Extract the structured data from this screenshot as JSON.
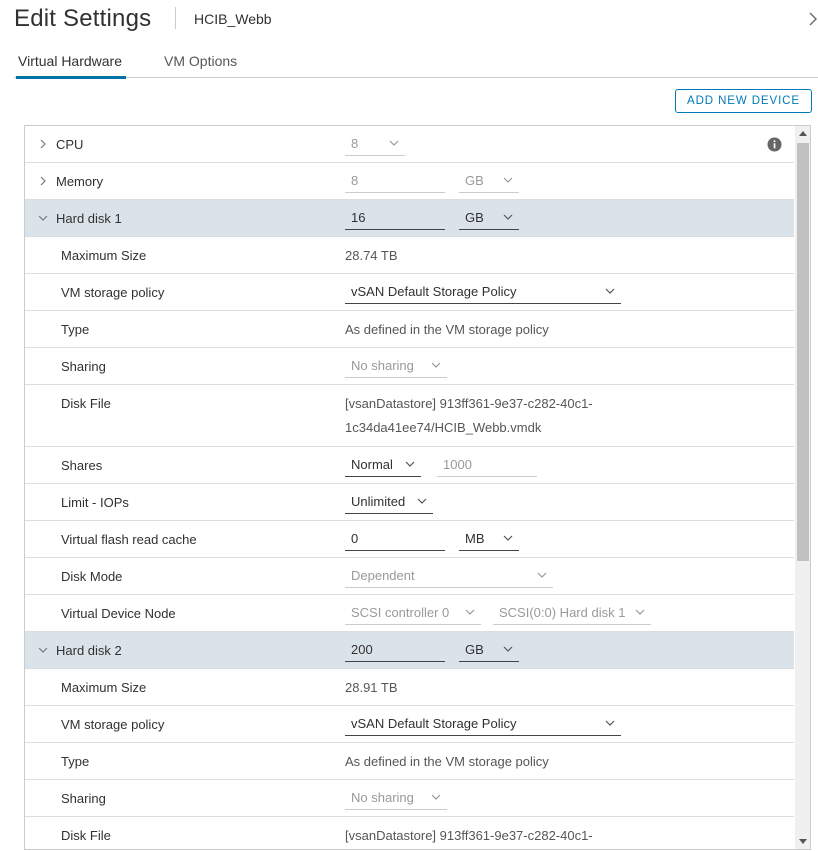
{
  "header": {
    "title": "Edit Settings",
    "vm_name": "HCIB_Webb"
  },
  "tabs": [
    {
      "label": "Virtual Hardware"
    },
    {
      "label": "VM Options"
    }
  ],
  "toolbar": {
    "add_device_label": "ADD NEW DEVICE"
  },
  "cpu": {
    "label": "CPU",
    "value": "8"
  },
  "memory": {
    "label": "Memory",
    "value": "8",
    "unit": "GB"
  },
  "disk1": {
    "label": "Hard disk 1",
    "size": "16",
    "unit": "GB",
    "max_size_label": "Maximum Size",
    "max_size": "28.74 TB",
    "policy_label": "VM storage policy",
    "policy": "vSAN Default Storage Policy",
    "type_label": "Type",
    "type": "As defined in the VM storage policy",
    "sharing_label": "Sharing",
    "sharing": "No sharing",
    "file_label": "Disk File",
    "file_line1": "[vsanDatastore] 913ff361-9e37-c282-40c1-",
    "file_line2": "1c34da41ee74/HCIB_Webb.vmdk",
    "shares_label": "Shares",
    "shares": "Normal",
    "shares_value": "1000",
    "limit_label": "Limit - IOPs",
    "limit": "Unlimited",
    "cache_label": "Virtual flash read cache",
    "cache": "0",
    "cache_unit": "MB",
    "mode_label": "Disk Mode",
    "mode": "Dependent",
    "node_label": "Virtual Device Node",
    "controller": "SCSI controller 0",
    "node": "SCSI(0:0) Hard disk 1"
  },
  "disk2": {
    "label": "Hard disk 2",
    "size": "200",
    "unit": "GB",
    "max_size_label": "Maximum Size",
    "max_size": "28.91 TB",
    "policy_label": "VM storage policy",
    "policy": "vSAN Default Storage Policy",
    "type_label": "Type",
    "type": "As defined in the VM storage policy",
    "sharing_label": "Sharing",
    "sharing": "No sharing",
    "file_label": "Disk File",
    "file_line1": "[vsanDatastore] 913ff361-9e37-c282-40c1-"
  },
  "icons": {
    "caret_right": "chevron-right-icon",
    "caret_down": "chevron-down-icon",
    "info": "info-icon",
    "header_chevron": "chevron-right-icon"
  },
  "colors": {
    "accent": "#0072a3",
    "button": "#0079b8",
    "expanded_row": "#dbe3ea"
  }
}
